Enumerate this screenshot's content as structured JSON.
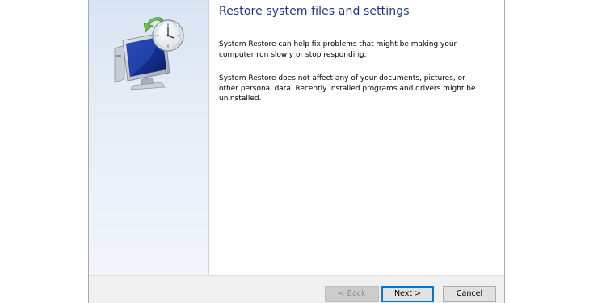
{
  "wizard": {
    "title": "Restore system files and settings",
    "paragraph_1": "System Restore can help fix problems that might be making your computer run slowly or stop responding.",
    "paragraph_2": "System Restore does not affect any of your documents, pictures, or other personal data. Recently installed programs and drivers might be uninstalled.",
    "hero_icon": "system-restore-icon"
  },
  "buttons": {
    "back": "< Back",
    "next": "Next >",
    "cancel": "Cancel"
  },
  "colors": {
    "title": "#1e3287",
    "sidebar": "#dfe8f4",
    "footer": "#f0f0f0",
    "default_button_border": "#0078d7"
  }
}
